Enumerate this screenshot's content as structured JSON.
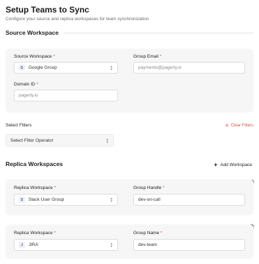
{
  "header": {
    "title": "Setup Teams to Sync",
    "subtitle": "Configure your source and replica workspaces for team synchronization"
  },
  "source": {
    "heading": "Source Workspace",
    "workspace_label": "Source Workspace",
    "workspace_value": "Google Group",
    "workspace_badge": "G",
    "email_label": "Group Email",
    "email_placeholder": "payments@pagerly.io",
    "domain_label": "Domain ID",
    "domain_placeholder": "pagerly.io"
  },
  "filters": {
    "label": "Select Filters",
    "clear_label": "Clear Filters",
    "operator_placeholder": "Select Filter Operator"
  },
  "replicas": {
    "heading": "Replica Workspaces",
    "add_label": "Add Workspace",
    "items": [
      {
        "workspace_label": "Replica Workspace",
        "workspace_value": "Slack User Group",
        "workspace_badge": "S",
        "field_label": "Group Handle",
        "field_value": "dev-on-call"
      },
      {
        "workspace_label": "Replica Workspace",
        "workspace_value": "JIRA",
        "workspace_badge": "J",
        "field_label": "Group Name",
        "field_value": "dev-team"
      }
    ]
  },
  "required_marker": "*",
  "colors": {
    "danger": "#d9534f",
    "card_bg": "#f6f6f6"
  }
}
